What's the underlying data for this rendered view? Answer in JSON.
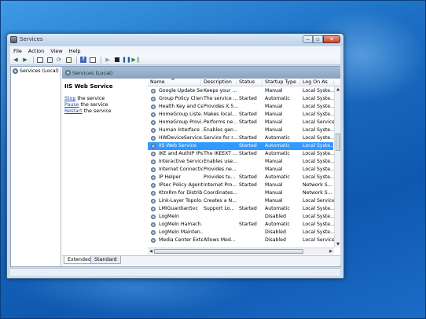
{
  "window": {
    "title": "Services"
  },
  "menu": [
    "File",
    "Action",
    "View",
    "Help"
  ],
  "tree": {
    "root_label": "Services (Local)"
  },
  "pane": {
    "header": "Services (Local)",
    "detail_title": "IIS Web Service",
    "actions": [
      {
        "link": "Stop",
        "rest": " the service"
      },
      {
        "link": "Pause",
        "rest": " the service"
      },
      {
        "link": "Restart",
        "rest": " the service"
      }
    ]
  },
  "columns": [
    "Name",
    "Description",
    "Status",
    "Startup Type",
    "Log On As"
  ],
  "rows": [
    {
      "name": "Google Update Se...",
      "desc": "Keeps your ...",
      "status": "",
      "startup": "Manual",
      "logon": "Local Syste..."
    },
    {
      "name": "Group Policy Client",
      "desc": "The service ...",
      "status": "Started",
      "startup": "Automatic",
      "logon": "Local Syste..."
    },
    {
      "name": "Health Key and Ce...",
      "desc": "Provides X.5...",
      "status": "",
      "startup": "Manual",
      "logon": "Local Syste..."
    },
    {
      "name": "HomeGroup Liste...",
      "desc": "Makes local...",
      "status": "Started",
      "startup": "Manual",
      "logon": "Local Syste..."
    },
    {
      "name": "HomeGroup Provi...",
      "desc": "Performs ne...",
      "status": "Started",
      "startup": "Manual",
      "logon": "Local Service"
    },
    {
      "name": "Human Interface ...",
      "desc": "Enables gen...",
      "status": "",
      "startup": "Manual",
      "logon": "Local Syste..."
    },
    {
      "name": "HWDeviceService...",
      "desc": "Service for r...",
      "status": "Started",
      "startup": "Automatic",
      "logon": "Local Syste..."
    },
    {
      "name": "IIS Web Service",
      "desc": "",
      "status": "Started",
      "startup": "Automatic",
      "logon": "Local Syste...",
      "selected": true
    },
    {
      "name": "IKE and AuthIP IPs...",
      "desc": "The IKEEXT ...",
      "status": "Started",
      "startup": "Automatic",
      "logon": "Local Syste..."
    },
    {
      "name": "Interactive Service...",
      "desc": "Enables use...",
      "status": "",
      "startup": "Manual",
      "logon": "Local Syste..."
    },
    {
      "name": "Internet Connectio...",
      "desc": "Provides ne...",
      "status": "",
      "startup": "Manual",
      "logon": "Local Syste..."
    },
    {
      "name": "IP Helper",
      "desc": "Provides tu...",
      "status": "Started",
      "startup": "Automatic",
      "logon": "Local Syste..."
    },
    {
      "name": "IPsec Policy Agent",
      "desc": "Internet Pro...",
      "status": "Started",
      "startup": "Manual",
      "logon": "Network S..."
    },
    {
      "name": "KtmRm for Distrib...",
      "desc": "Coordinates...",
      "status": "",
      "startup": "Manual",
      "logon": "Network S..."
    },
    {
      "name": "Link-Layer Topolo...",
      "desc": "Creates a N...",
      "status": "",
      "startup": "Manual",
      "logon": "Local Service"
    },
    {
      "name": "LMIGuardianSvc",
      "desc": "Support Lo...",
      "status": "Started",
      "startup": "Automatic",
      "logon": "Local Syste..."
    },
    {
      "name": "LogMeIn",
      "desc": "",
      "status": "",
      "startup": "Disabled",
      "logon": "Local Syste..."
    },
    {
      "name": "LogMeIn Hamach...",
      "desc": "",
      "status": "Started",
      "startup": "Automatic",
      "logon": "Local Syste..."
    },
    {
      "name": "LogMeIn Mainten...",
      "desc": "",
      "status": "",
      "startup": "Disabled",
      "logon": "Local Syste..."
    },
    {
      "name": "Media Center Exte...",
      "desc": "Allows Med...",
      "status": "",
      "startup": "Disabled",
      "logon": "Local Service"
    }
  ],
  "tabs": [
    "Extended",
    "Standard"
  ]
}
